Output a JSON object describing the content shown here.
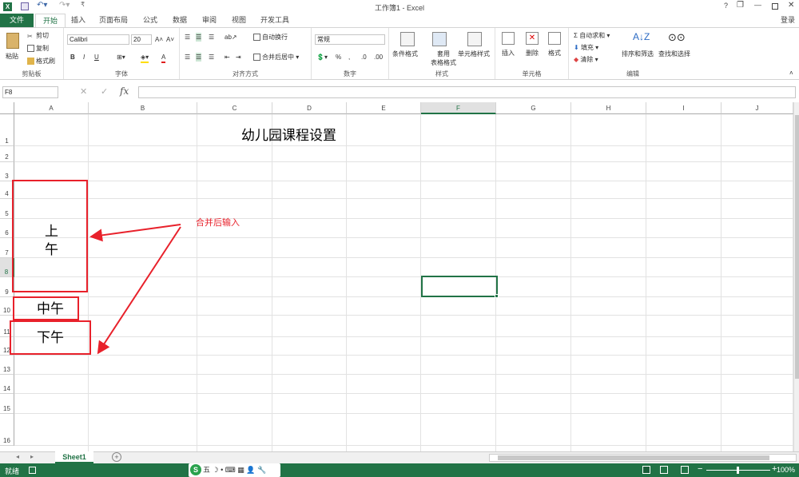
{
  "window": {
    "title": "工作簿1 - Excel",
    "help": "?",
    "min": "—",
    "restore": "❐",
    "close": "✕",
    "login": "登录"
  },
  "tabs": [
    "文件",
    "开始",
    "插入",
    "页面布局",
    "公式",
    "数据",
    "审阅",
    "视图",
    "开发工具"
  ],
  "ribbon": {
    "clipboard": {
      "paste": "粘贴",
      "cut": "剪切",
      "copy": "复制",
      "format_painter": "格式刷",
      "label": "剪贴板"
    },
    "font": {
      "name": "Calibri",
      "size": "20",
      "bold": "B",
      "italic": "I",
      "underline": "U",
      "grow": "A˄",
      "shrink": "A˅",
      "color": "A",
      "label": "字体"
    },
    "alignment": {
      "wrap": "自动换行",
      "merge": "合并后居中",
      "label": "对齐方式"
    },
    "number": {
      "format": "常规",
      "percent": "%",
      "comma": ",",
      "label": "数字"
    },
    "styles": {
      "conditional": "条件格式",
      "table": "套用\n表格格式",
      "cell": "单元格样式",
      "table_l1": "套用",
      "table_l2": "表格格式",
      "label": "样式"
    },
    "cells": {
      "insert": "插入",
      "delete": "删除",
      "format": "格式",
      "label": "单元格"
    },
    "editing": {
      "autosum": "自动求和",
      "fill": "填充",
      "clear": "清除",
      "sort": "排序和筛选",
      "find": "查找和选择",
      "label": "编辑"
    }
  },
  "formula_bar": {
    "name_box": "F8",
    "fx": "fx",
    "content": ""
  },
  "columns": [
    "A",
    "B",
    "C",
    "D",
    "E",
    "F",
    "G",
    "H",
    "I",
    "J"
  ],
  "rows": [
    "1",
    "2",
    "3",
    "4",
    "5",
    "6",
    "7",
    "8",
    "9",
    "10",
    "11",
    "12",
    "13",
    "14",
    "15",
    "16"
  ],
  "cells": {
    "title": "幼儿园课程设置",
    "morning_1": "上",
    "morning_2": "午",
    "noon": "中午",
    "afternoon": "下午"
  },
  "annotation": "合并后输入",
  "sheet_tab": "Sheet1",
  "add_sheet": "+",
  "status": {
    "ready": "就绪",
    "zoom": "100%",
    "ime": "五"
  },
  "colors": {
    "excel_green": "#217346",
    "annotation_red": "#e8212b",
    "selection_green": "#217346"
  }
}
